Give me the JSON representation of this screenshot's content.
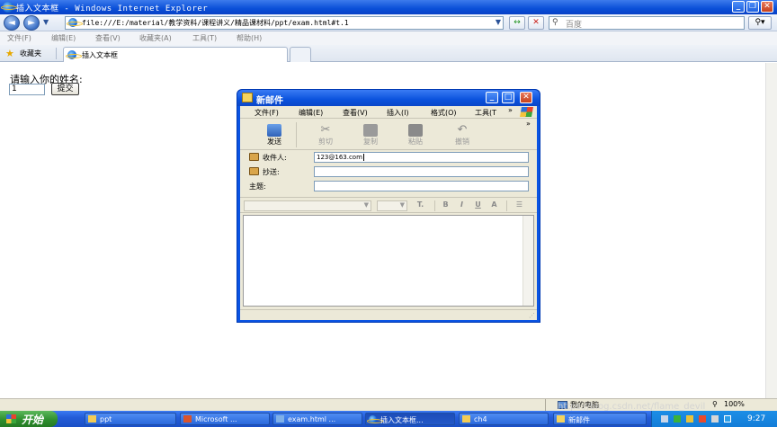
{
  "window": {
    "title": "插入文本框 - Windows Internet Explorer"
  },
  "navbar": {
    "address": "file:///E:/material/教学资料/课程讲义/精品课材料/ppt/exam.html#t.1",
    "search_placeholder": "百度",
    "back_label": "◄",
    "forward_label": "►"
  },
  "menubar": {
    "items": [
      "文件(F)",
      "编辑(E)",
      "查看(V)",
      "收藏夹(A)",
      "工具(T)",
      "帮助(H)"
    ]
  },
  "tabbar": {
    "favorites_label": "收藏夹",
    "tab_label": "插入文本框"
  },
  "page": {
    "prompt": "请输入你的姓名:",
    "name_value": "1",
    "submit_label": "提交"
  },
  "mail": {
    "title": "新邮件",
    "menu": [
      "文件(F)",
      "编辑(E)",
      "查看(V)",
      "插入(I)",
      "格式(O)",
      "工具(T"
    ],
    "menu_more": "»",
    "toolbar_more": "»",
    "toolbar": {
      "send": "发送",
      "cut": "剪切",
      "copy": "复制",
      "paste": "粘贴",
      "undo": "撤销"
    },
    "fields": {
      "to_label": "收件人:",
      "to_value": "123@163.com",
      "cc_label": "抄送:",
      "cc_value": "",
      "subject_label": "主题:",
      "subject_value": ""
    },
    "format": {
      "bold": "B",
      "italic": "I",
      "underline": "U",
      "color": "A"
    }
  },
  "statusbar": {
    "zone": "我的电脑",
    "zoom": "100%"
  },
  "taskbar": {
    "start_label": "开始",
    "tasks": [
      "ppt",
      "Microsoft ...",
      "exam.html ...",
      "插入文本框...",
      "ch4",
      "新邮件"
    ],
    "clock": "9:27"
  },
  "watermark": "https://blog.csdn.net/flame_devil",
  "colors": {
    "xp_blue": "#0a54e3",
    "start_green": "#2f8f2f",
    "dialog_face": "#ece9d8"
  }
}
